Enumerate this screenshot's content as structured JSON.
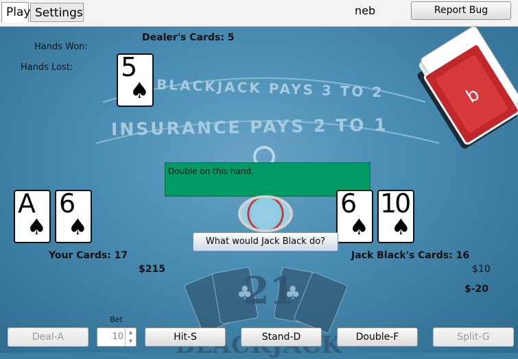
{
  "tabs": [
    {
      "label": "Play",
      "active": true
    },
    {
      "label": "Settings",
      "active": false
    }
  ],
  "user": {
    "name": "neb"
  },
  "report_bug": "Report Bug",
  "dealer": {
    "cards_label": "Dealer's Cards: 5",
    "cards": [
      {
        "rank": "5",
        "suit": "♠"
      }
    ]
  },
  "stats": {
    "hands_won": "Hands Won:",
    "hands_lost": "Hands Lost:"
  },
  "table_text": {
    "blackjack_pays": "BLACKJACK PAYS 3 TO 2",
    "insurance_pays": "INSURANCE PAYS 2 TO 1",
    "logo_number": "21",
    "logo_word": "BLACKJACK"
  },
  "hint": "Double on this hand.",
  "ask_button": "What would Jack Black do?",
  "player": {
    "cards_label": "Your Cards: 17",
    "money": "$215",
    "cards": [
      {
        "rank": "A",
        "suit": "♠"
      },
      {
        "rank": "6",
        "suit": "♠"
      }
    ]
  },
  "opponent": {
    "cards_label": "Jack Black's Cards: 16",
    "bet": "$10",
    "net": "$-20",
    "cards": [
      {
        "rank": "6",
        "suit": "♠"
      },
      {
        "rank": "10",
        "suit": "♠"
      }
    ]
  },
  "controls": {
    "bet_label": "Bet",
    "bet_value": "10",
    "deal": "Deal-A",
    "hit": "Hit-S",
    "stand": "Stand-D",
    "double": "Double-F",
    "split": "Split-G"
  },
  "colors": {
    "felt": "#4a8db3",
    "hint_bg": "#009a66",
    "deck_red": "#c0282c"
  },
  "icons": {
    "suit": "spade-icon",
    "deck": "card-deck-icon"
  }
}
